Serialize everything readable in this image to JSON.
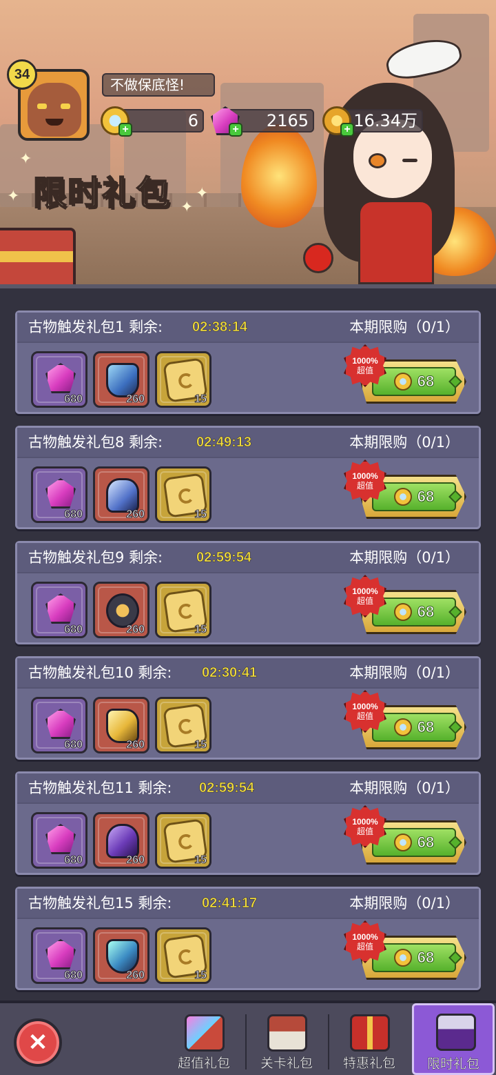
{
  "header": {
    "level": "34",
    "player_name": "不做保底怪!",
    "resources": [
      {
        "icon": "blue-gem-coin-icon",
        "value": "6"
      },
      {
        "icon": "pink-gem-icon",
        "value": "2165"
      },
      {
        "icon": "gold-coin-icon",
        "value": "16.34万"
      }
    ],
    "title": "限时礼包"
  },
  "packs": [
    {
      "name": "古物触发礼包1",
      "remain_label": "剩余:",
      "timer": "02:38:14",
      "limit": "本期限购（0/1）",
      "items": [
        {
          "icon": "pink-gem-icon",
          "qty": "680"
        },
        {
          "icon": "blue-mask-relic-icon",
          "qty": "260"
        },
        {
          "icon": "gold-relic-coin-icon",
          "qty": "15"
        }
      ],
      "badge_pct": "1000%",
      "badge_text": "超值",
      "price": "68"
    },
    {
      "name": "古物触发礼包8",
      "remain_label": "剩余:",
      "timer": "02:49:13",
      "limit": "本期限购（0/1）",
      "items": [
        {
          "icon": "pink-gem-icon",
          "qty": "680"
        },
        {
          "icon": "crown-relic-icon",
          "qty": "260"
        },
        {
          "icon": "gold-relic-coin-icon",
          "qty": "15"
        }
      ],
      "badge_pct": "1000%",
      "badge_text": "超值",
      "price": "68"
    },
    {
      "name": "古物触发礼包9",
      "remain_label": "剩余:",
      "timer": "02:59:54",
      "limit": "本期限购（0/1）",
      "items": [
        {
          "icon": "pink-gem-icon",
          "qty": "680"
        },
        {
          "icon": "skull-amulet-relic-icon",
          "qty": "260"
        },
        {
          "icon": "gold-relic-coin-icon",
          "qty": "15"
        }
      ],
      "badge_pct": "1000%",
      "badge_text": "超值",
      "price": "68"
    },
    {
      "name": "古物触发礼包10",
      "remain_label": "剩余:",
      "timer": "02:30:41",
      "limit": "本期限购（0/1）",
      "items": [
        {
          "icon": "pink-gem-icon",
          "qty": "680"
        },
        {
          "icon": "golden-horn-relic-icon",
          "qty": "260"
        },
        {
          "icon": "gold-relic-coin-icon",
          "qty": "15"
        }
      ],
      "badge_pct": "1000%",
      "badge_text": "超值",
      "price": "68"
    },
    {
      "name": "古物触发礼包11",
      "remain_label": "剩余:",
      "timer": "02:59:54",
      "limit": "本期限购（0/1）",
      "items": [
        {
          "icon": "pink-gem-icon",
          "qty": "680"
        },
        {
          "icon": "purple-helmet-relic-icon",
          "qty": "260"
        },
        {
          "icon": "gold-relic-coin-icon",
          "qty": "15"
        }
      ],
      "badge_pct": "1000%",
      "badge_text": "超值",
      "price": "68"
    },
    {
      "name": "古物触发礼包15",
      "remain_label": "剩余:",
      "timer": "02:41:17",
      "limit": "本期限购（0/1）",
      "items": [
        {
          "icon": "pink-gem-icon",
          "qty": "680"
        },
        {
          "icon": "lightning-shield-relic-icon",
          "qty": "260"
        },
        {
          "icon": "gold-relic-coin-icon",
          "qty": "15"
        }
      ],
      "badge_pct": "1000%",
      "badge_text": "超值",
      "price": "68"
    }
  ],
  "nav": {
    "close_icon": "close-icon",
    "tabs": [
      {
        "label": "超值礼包",
        "icon": "gift-gems-icon",
        "active": false
      },
      {
        "label": "关卡礼包",
        "icon": "skull-chest-icon",
        "active": false
      },
      {
        "label": "特惠礼包",
        "icon": "red-gift-box-icon",
        "active": false
      },
      {
        "label": "限时礼包",
        "icon": "hero-portrait-icon",
        "active": true
      }
    ]
  },
  "colors": {
    "timer": "#f4df3c",
    "card_bg": "#6b6a8c",
    "buy_green": "#56b12c",
    "active_tab": "#8c59d6"
  }
}
